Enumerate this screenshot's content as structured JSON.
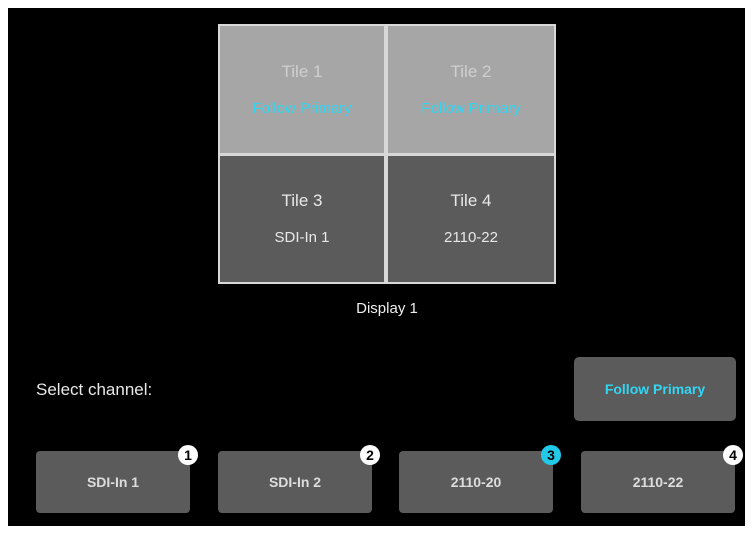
{
  "tiles": [
    {
      "title": "Tile 1",
      "source": "Follow Primary"
    },
    {
      "title": "Tile 2",
      "source": "Follow Primary"
    },
    {
      "title": "Tile 3",
      "source": "SDI-In 1"
    },
    {
      "title": "Tile 4",
      "source": "2110-22"
    }
  ],
  "display_label": "Display 1",
  "select_label": "Select channel:",
  "follow_primary_button": "Follow Primary",
  "channels": [
    {
      "label": "SDI-In 1",
      "badge": "1"
    },
    {
      "label": "SDI-In 2",
      "badge": "2"
    },
    {
      "label": "2110-20",
      "badge": "3"
    },
    {
      "label": "2110-22",
      "badge": "4"
    }
  ],
  "selected_channel": "3",
  "colors": {
    "accent": "#33d6f2",
    "badge_selected": "#22c9e8",
    "tile_active": "#a6a6a6",
    "tile_inactive": "#5b5b5b",
    "button": "#5b5b5b",
    "background": "#000000"
  }
}
